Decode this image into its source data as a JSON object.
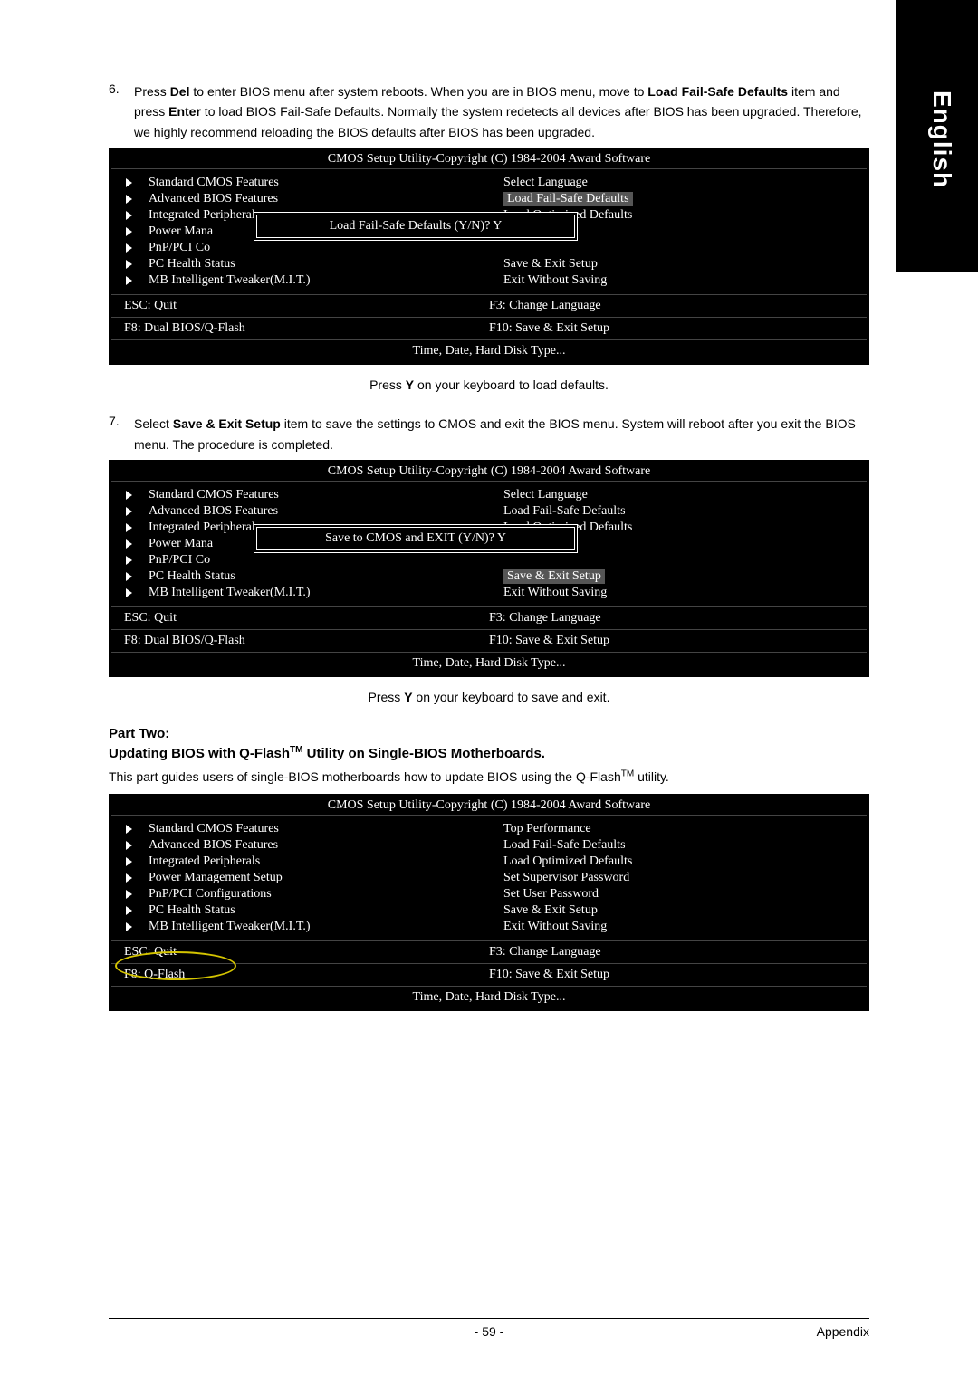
{
  "sideLabel": "English",
  "step6": {
    "num": "6.",
    "textParts": [
      "Press ",
      "Del",
      " to enter BIOS menu after system reboots. When you are in BIOS menu, move to ",
      "Load Fail-Safe Defaults",
      " item and press ",
      "Enter",
      " to load BIOS Fail-Safe Defaults. Normally the system redetects all devices after BIOS has been upgraded. Therefore, we highly recommend reloading the BIOS defaults after BIOS has been upgraded."
    ]
  },
  "caption1": [
    "Press ",
    "Y",
    " on your keyboard to load defaults."
  ],
  "step7": {
    "num": "7.",
    "textParts": [
      "Select ",
      "Save & Exit Setup",
      " item to save the settings to CMOS and exit the BIOS menu. System will reboot after you exit the BIOS menu. The procedure is completed."
    ]
  },
  "caption2": [
    "Press ",
    "Y",
    " on your keyboard to save and exit."
  ],
  "partTwo": "Part Two:",
  "partTwoSub": [
    "Updating BIOS with Q-Flash",
    "TM",
    " Utility on Single-BIOS Motherboards."
  ],
  "partTwoBody": [
    "This part guides users of single-BIOS motherboards how to update BIOS using the Q-Flash",
    "TM",
    " utility."
  ],
  "bios1": {
    "title": "CMOS Setup Utility-Copyright (C) 1984-2004 Award Software",
    "left": [
      "Standard CMOS Features",
      "Advanced BIOS Features",
      "Integrated Peripherals",
      "Power Mana",
      "PnP/PCI Co",
      "PC Health Status",
      "MB Intelligent Tweaker(M.I.T.)"
    ],
    "right": [
      "Select Language",
      "Load Fail-Safe Defaults",
      "Load Optimized Defaults",
      "",
      "",
      "Save & Exit Setup",
      "Exit Without Saving"
    ],
    "rightSelectedIndex": 1,
    "dialog": "Load Fail-Safe Defaults (Y/N)? Y",
    "foot": {
      "l1": "ESC: Quit",
      "r1": "F3: Change Language",
      "l2": "F8: Dual BIOS/Q-Flash",
      "r2": "F10: Save & Exit Setup"
    },
    "hint": "Time, Date, Hard Disk Type..."
  },
  "bios2": {
    "title": "CMOS Setup Utility-Copyright (C) 1984-2004 Award Software",
    "left": [
      "Standard CMOS Features",
      "Advanced BIOS Features",
      "Integrated Peripherals",
      "Power Mana",
      "PnP/PCI Co",
      "PC Health Status",
      "MB Intelligent Tweaker(M.I.T.)"
    ],
    "right": [
      "Select Language",
      "Load Fail-Safe Defaults",
      "Load Optimized Defaults",
      "",
      "",
      "Save & Exit Setup",
      "Exit Without Saving"
    ],
    "rightSelectedIndex": 5,
    "dialog": "Save to CMOS and EXIT (Y/N)? Y",
    "foot": {
      "l1": "ESC: Quit",
      "r1": "F3: Change Language",
      "l2": "F8: Dual BIOS/Q-Flash",
      "r2": "F10: Save & Exit Setup"
    },
    "hint": "Time, Date, Hard Disk Type..."
  },
  "bios3": {
    "title": "CMOS Setup Utility-Copyright (C) 1984-2004 Award Software",
    "left": [
      "Standard CMOS Features",
      "Advanced BIOS Features",
      "Integrated Peripherals",
      "Power Management Setup",
      "PnP/PCI Configurations",
      "PC Health Status",
      "MB Intelligent Tweaker(M.I.T.)"
    ],
    "right": [
      "Top Performance",
      "Load Fail-Safe Defaults",
      "Load Optimized Defaults",
      "Set Supervisor Password",
      "Set User Password",
      "Save & Exit Setup",
      "Exit Without Saving"
    ],
    "foot": {
      "l1": "ESC: Quit",
      "r1": "F3: Change Language",
      "l2": "F8: Q-Flash",
      "r2": "F10: Save & Exit Setup"
    },
    "hint": "Time, Date, Hard Disk Type..."
  },
  "footer": {
    "page": "- 59 -",
    "section": "Appendix"
  }
}
